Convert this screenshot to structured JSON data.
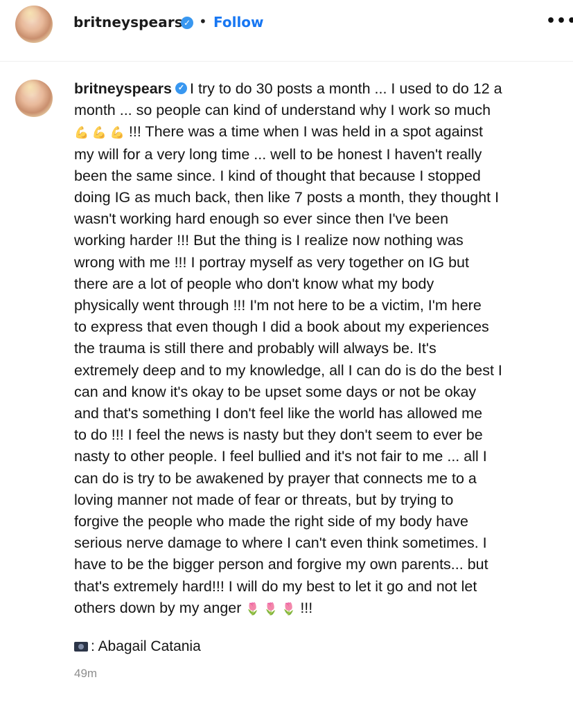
{
  "header": {
    "username": "britneyspears",
    "verified_mark": "✓",
    "separator": "•",
    "follow_label": "Follow",
    "more_label": "•••"
  },
  "caption": {
    "username": "britneyspears",
    "line1": "I try to do 30 posts a month ... I used to do 12 a",
    "line2": "month ... so people can kind of understand why I work so much",
    "muscle_emojis": "💪 💪 💪",
    "line3": " !!! There was a time when I was held in a spot against",
    "line4": "my will for a very long time ... well to be honest I haven't really",
    "line5": "been the same since. I kind of thought that because I stopped",
    "line6": "doing IG as much back, then like 7 posts a month, they thought I",
    "line7": "wasn't working hard enough so ever since then I've been",
    "line8": "working harder !!! But the thing is I realize now nothing was",
    "line9": "wrong with me !!! I portray myself as very together on IG but",
    "line10": "there are a lot of people who don't know what my body",
    "line11": "physically went through !!! I'm not here to be a victim, I'm here",
    "line12": "to express that even though I did a book about my experiences",
    "line13": "the trauma is still there and probably will always be. It's",
    "line14": "extremely deep and to my knowledge, all I can do is do the best I",
    "line15": "can and know it's okay to be upset some days or not be okay",
    "line16": "and that's something I don't feel like the world has allowed me",
    "line17": "to do !!! I feel the news is nasty but they don't seem to ever be",
    "line18": "nasty to other people. I feel bullied and it's not fair to me ... all I",
    "line19": "can do is try to be awakened by prayer that connects me to a",
    "line20": "loving manner not made of fear or threats, but by trying to",
    "line21": "forgive the people who made the right side of my body have",
    "line22": "serious nerve damage to where I can't even think sometimes. I",
    "line23": "have to be the bigger person and forgive my own parents... but",
    "line24": "that's extremely hard!!! I will do my best to let it go and not let",
    "line25": "others down by my anger ",
    "tulip_emojis": "🌷 🌷 🌷",
    "line25_end": " !!!"
  },
  "credit": {
    "icon": "camera-icon",
    "text": ": Abagail Catania"
  },
  "timestamp": "49m",
  "colors": {
    "follow": "#1877f2",
    "verified": "#3897f0",
    "timestamp": "#8e8e8e"
  }
}
